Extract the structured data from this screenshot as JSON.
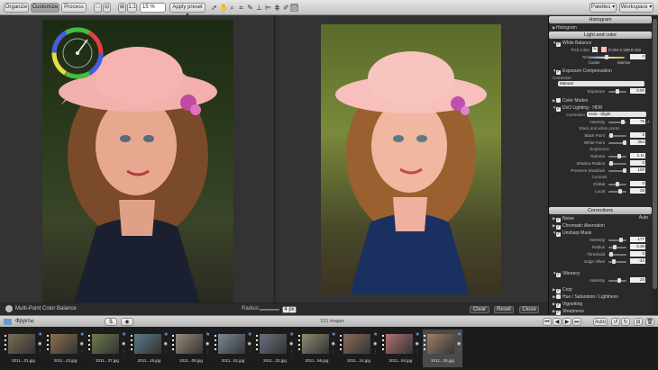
{
  "toolbar": {
    "tabs": [
      {
        "label": "Organize",
        "active": false
      },
      {
        "label": "Customize",
        "active": true
      },
      {
        "label": "Process",
        "active": false
      }
    ],
    "view_buttons": [
      "□",
      "⊟",
      "⊞",
      "1:1"
    ],
    "zoom": "15 %",
    "apply_preset": "Apply preset",
    "palettes": "Palettes",
    "workspace": "Workspace"
  },
  "viewer": {
    "radius_label": "Radius:",
    "radius_value": "4 px",
    "clear_label": "Clear",
    "reset_label": "Reset",
    "close_label": "Close",
    "tool_name": "Multi-Point Color Balance"
  },
  "panel": {
    "histogram_header": "Histogram",
    "histogram_row": "Histogram",
    "light_color_header": "Light and color",
    "white_balance": {
      "title": "White Balance",
      "pick_color": "Pick Color",
      "pick_value": "R:254 G:188 B:183",
      "temperature": "Temperature",
      "temp_value": "0",
      "cooler": "Cooler",
      "warmer": "Warmer"
    },
    "exposure": {
      "title": "Exposure Compensation",
      "correction_label": "Correction",
      "correction_value": "Manual",
      "exposure_label": "Exposure",
      "exposure_value": "0.00"
    },
    "color_modes": "Color Modes",
    "dxo_lighting": {
      "title": "DxO Lighting - HDR",
      "correction_label": "Correction",
      "correction_value": "Auto - Slight",
      "intensity_label": "Intensity",
      "intensity_value": "75",
      "bw_header": "Black and white points",
      "black_point_label": "Black Point",
      "black_point_value": "5",
      "white_point_label": "White Point",
      "white_point_value": "254",
      "brightness_header": "Brightness",
      "gamma_label": "Gamma",
      "gamma_value": "1.11",
      "shadow_label": "Shadow Radius",
      "shadow_value": "0",
      "preserve_label": "Preserve Shadows",
      "preserve_value": "100",
      "contrast_header": "Contrast",
      "global_label": "Global",
      "global_value": "0",
      "local_label": "Local",
      "local_value": "38"
    },
    "corrections_header": "Corrections",
    "noise": "Noise",
    "noise_mode": "Auto",
    "chromatic": "Chromatic Aberration",
    "unsharp": {
      "title": "Unsharp Mask",
      "intensity_label": "Intensity",
      "intensity_value": "177",
      "radius_label": "Radius",
      "radius_value": "0.39",
      "threshold_label": "Threshold",
      "threshold_value": "0",
      "edge_label": "Edge offset",
      "edge_value": "-42"
    },
    "vibrancy": {
      "title": "Vibrancy",
      "intensity_label": "Intensity",
      "intensity_value": "24"
    },
    "crop": "Crop",
    "hsl": "Hue / Saturation / Lightness",
    "vignetting": "Vignetting",
    "sharpness": "Sharpness"
  },
  "browser": {
    "folder": "Фрукты",
    "count": "1/11 images",
    "auto": "Auto"
  },
  "thumbnails": [
    {
      "name": "2011...01.jpg",
      "color": "#7a6a55",
      "selected": false
    },
    {
      "name": "2011...43.jpg",
      "color": "#8a7050",
      "selected": false
    },
    {
      "name": "2011...37.jpg",
      "color": "#6d7a4a",
      "selected": false
    },
    {
      "name": "2011...15.jpg",
      "color": "#5a7a8a",
      "selected": false
    },
    {
      "name": "2011...09.jpg",
      "color": "#9a8a7a",
      "selected": false
    },
    {
      "name": "2011...51.jpg",
      "color": "#7a8a9a",
      "selected": false
    },
    {
      "name": "2011...22.jpg",
      "color": "#6a7080",
      "selected": false
    },
    {
      "name": "2011...56.jpg",
      "color": "#8a8a70",
      "selected": false
    },
    {
      "name": "2011...14.jpg",
      "color": "#8a6a5a",
      "selected": false
    },
    {
      "name": "2011...54.jpg",
      "color": "#b07070",
      "selected": false
    },
    {
      "name": "2011...28.jpg",
      "color": "#a0806a",
      "selected": true
    }
  ]
}
